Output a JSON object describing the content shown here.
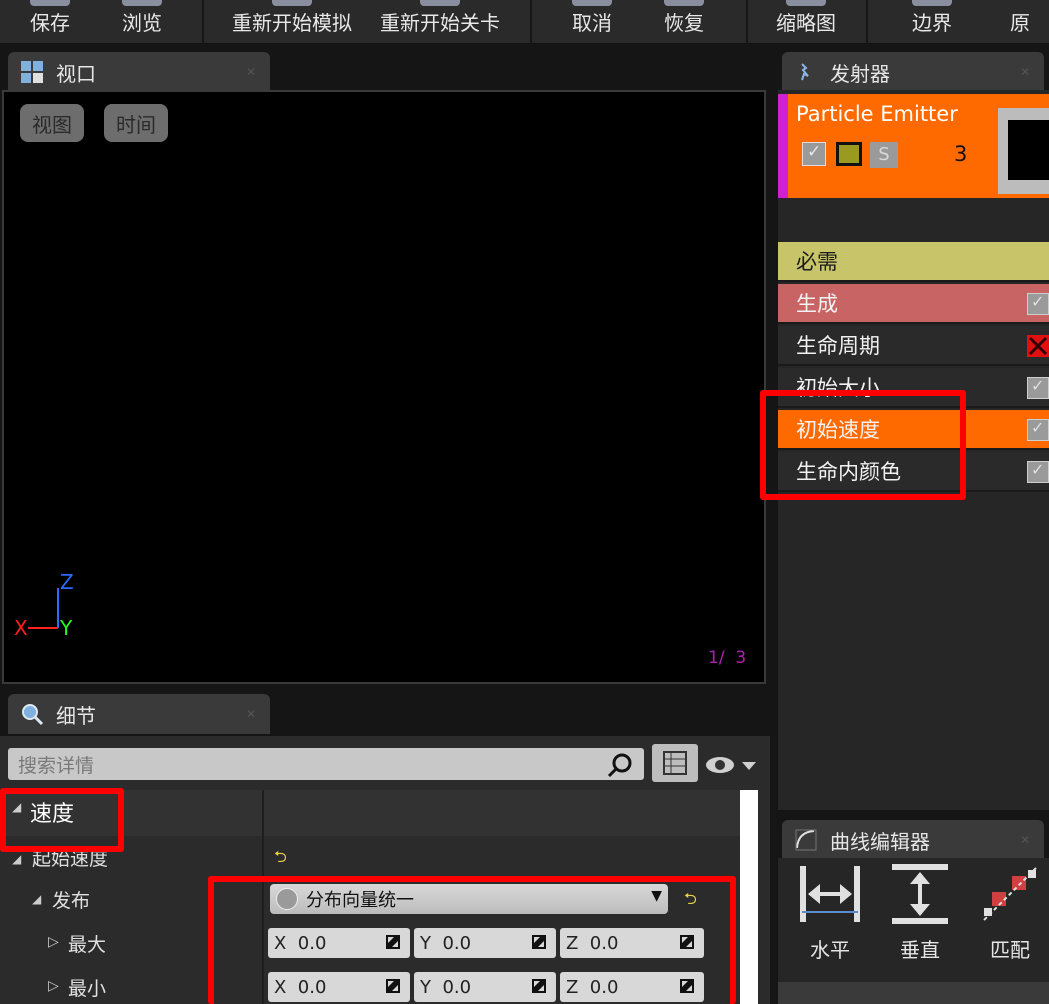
{
  "toolbar": {
    "items": [
      {
        "label": "保存"
      },
      {
        "label": "浏览"
      },
      {
        "label": "重新开始模拟"
      },
      {
        "label": "重新开始关卡"
      },
      {
        "label": "取消"
      },
      {
        "label": "恢复"
      },
      {
        "label": "缩略图"
      },
      {
        "label": "边界"
      },
      {
        "label": "⁠原"
      }
    ]
  },
  "viewport": {
    "tab_label": "视口",
    "view_button": "视图",
    "time_button": "时间",
    "axis_x": "X",
    "axis_y": "Y",
    "axis_z": "Z",
    "counter": "1/  3"
  },
  "emitter_panel": {
    "tab_label": "发射器",
    "emitter_name": "Particle Emitter",
    "emitter_count": "3",
    "s_badge": "S",
    "modules": [
      {
        "label": "必需",
        "color": "#c8c46a",
        "has_check": false,
        "text_color": "#1a1a1a"
      },
      {
        "label": "生成",
        "color": "#c86464",
        "has_check": true
      },
      {
        "label": "生命周期",
        "color": "#2a2a2a",
        "has_check": "x"
      },
      {
        "label": "初始大小",
        "color": "#2a2a2a",
        "has_check": true
      },
      {
        "label": "初始速度",
        "color": "#ff6a00",
        "has_check": true
      },
      {
        "label": "生命内颜色",
        "color": "#2a2a2a",
        "has_check": true
      }
    ]
  },
  "details": {
    "tab_label": "细节",
    "search_placeholder": "搜索详情",
    "category": "速度",
    "property_start_velocity": "起始速度",
    "property_distribution": "发布",
    "distribution_value": "分布向量统一",
    "property_max": "最大",
    "property_min": "最小",
    "max": {
      "x": "0.0",
      "y": "0.0",
      "z": "0.0"
    },
    "min": {
      "x": "0.0",
      "y": "0.0",
      "z": "0.0"
    },
    "label_x": "X",
    "label_y": "Y",
    "label_z": "Z"
  },
  "curve_editor": {
    "tab_label": "曲线编辑器",
    "horizontal": "水平",
    "vertical": "垂直",
    "fit": "匹配"
  },
  "colors": {
    "emitter_header": "#ff6a00",
    "highlight_red": "#ff0000",
    "accent_magenta": "#d020d0"
  }
}
